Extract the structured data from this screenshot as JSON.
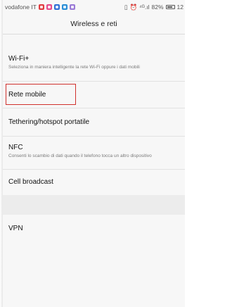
{
  "status_bar": {
    "carrier": "vodafone IT",
    "notification_icons": [
      {
        "name": "app-notification-icon",
        "color": "#e03a3e"
      },
      {
        "name": "app-notification-icon",
        "color": "#e64a8a"
      },
      {
        "name": "app-notification-icon",
        "color": "#2f6fd6"
      },
      {
        "name": "app-notification-icon",
        "color": "#2a8fd6"
      },
      {
        "name": "app-notification-icon",
        "color": "#9a7ad6"
      }
    ],
    "vibrate_glyph": "▯",
    "alarm_glyph": "⏰",
    "signal_text": "⁴ᴳ.ıl",
    "battery_percent": "82%",
    "battery_level": 0.82,
    "time": "12"
  },
  "header": {
    "title": "Wireless e reti"
  },
  "items": [
    {
      "title": "Wi-Fi+",
      "subtitle": "Seleziona in maniera intelligente la rete Wi-Fi oppure i dati mobili"
    },
    {
      "title": "Rete mobile"
    },
    {
      "title": "Tethering/hotspot portatile"
    },
    {
      "title": "NFC",
      "subtitle": "Consenti lo scambio di dati quando il telefono tocca un altro dispositivo"
    },
    {
      "title": "Cell broadcast"
    },
    {
      "title": "VPN"
    }
  ],
  "highlight_color": "#d0312d"
}
